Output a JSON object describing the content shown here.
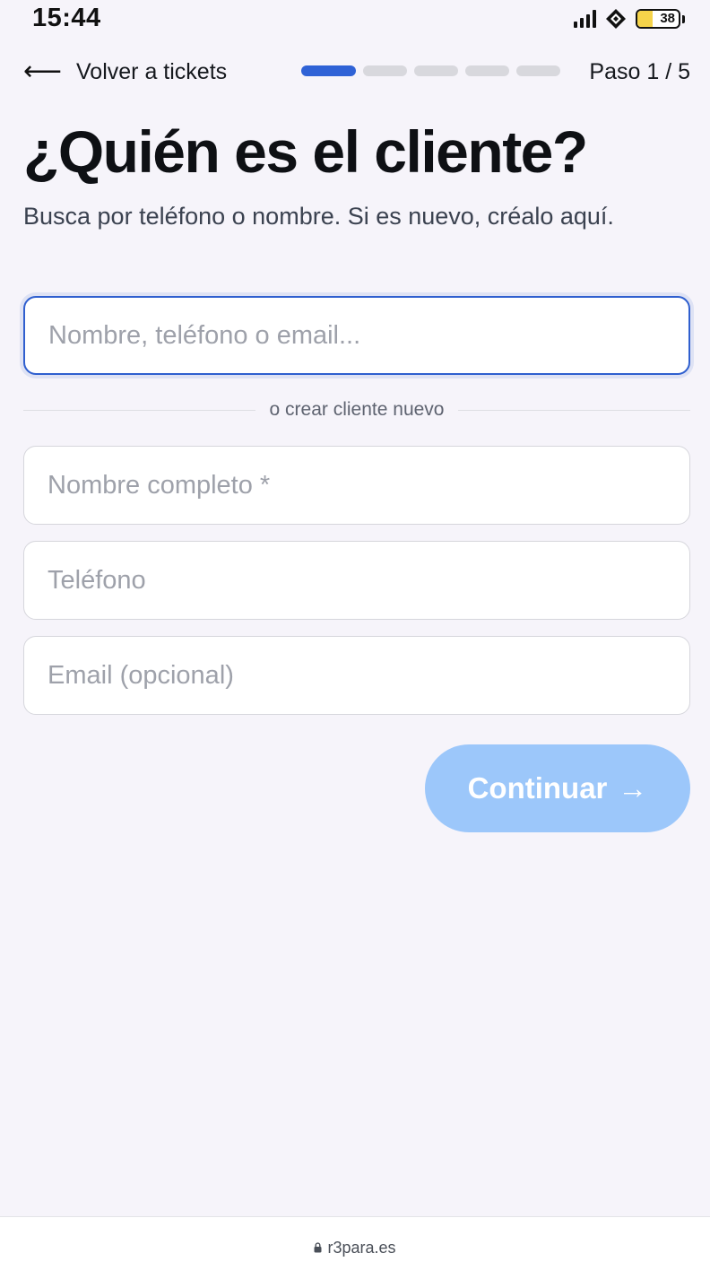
{
  "status_bar": {
    "time": "15:44",
    "battery_level": "38"
  },
  "nav": {
    "back_arrow": "⟵",
    "back_label": "Volver a tickets",
    "step_label": "Paso 1 / 5",
    "progress": {
      "current": 1,
      "total": 5
    }
  },
  "header": {
    "title": "¿Quién es el cliente?",
    "subtitle": "Busca por teléfono o nombre. Si es nuevo, créalo aquí."
  },
  "search": {
    "placeholder": "Nombre, teléfono o email...",
    "value": ""
  },
  "divider_label": "o crear cliente nuevo",
  "form": {
    "name_placeholder": "Nombre completo *",
    "phone_placeholder": "Teléfono",
    "email_placeholder": "Email (opcional)"
  },
  "continue": {
    "label": "Continuar",
    "arrow": "→"
  },
  "footer": {
    "url": "r3para.es"
  },
  "colors": {
    "accent": "#2f62d6",
    "button_disabled": "#9cc7fa",
    "background": "#f6f4fa"
  }
}
